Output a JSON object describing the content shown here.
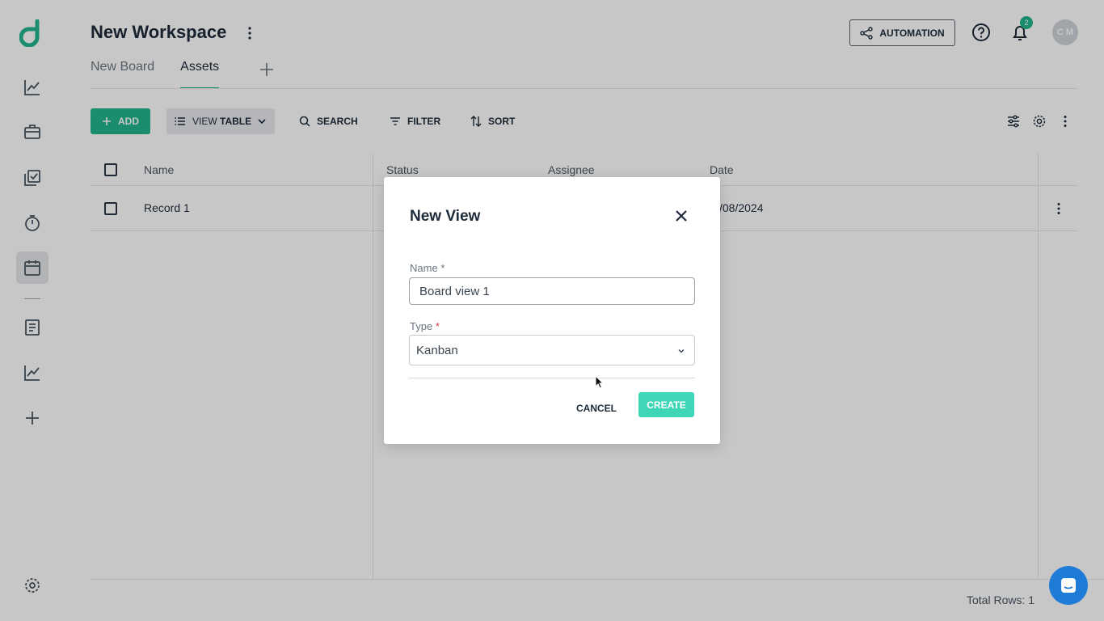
{
  "header": {
    "workspace_title": "New Workspace",
    "automation_label": "AUTOMATION",
    "notification_count": "2",
    "avatar_initials": "C M"
  },
  "tabs": [
    {
      "label": "New Board",
      "active": false
    },
    {
      "label": "Assets",
      "active": true
    }
  ],
  "toolbar": {
    "add_label": "ADD",
    "view_prefix": "VIEW",
    "view_value": "TABLE",
    "search_label": "SEARCH",
    "filter_label": "FILTER",
    "sort_label": "SORT"
  },
  "table": {
    "columns": [
      "Name",
      "Status",
      "Assignee",
      "Date"
    ],
    "rows": [
      {
        "name": "Record 1",
        "status": "",
        "assignee": "",
        "date": "/08/2024"
      }
    ],
    "total_rows_label": "Total Rows: 1"
  },
  "modal": {
    "title": "New View",
    "name_label": "Name",
    "name_required": "*",
    "name_value": "Board view 1",
    "type_label": "Type",
    "type_required": "*",
    "type_value": "Kanban",
    "cancel_label": "CANCEL",
    "create_label": "CREATE"
  },
  "colors": {
    "brand": "#21b58c",
    "create_button": "#3fd6b7",
    "chat_button": "#1f7bd8"
  }
}
